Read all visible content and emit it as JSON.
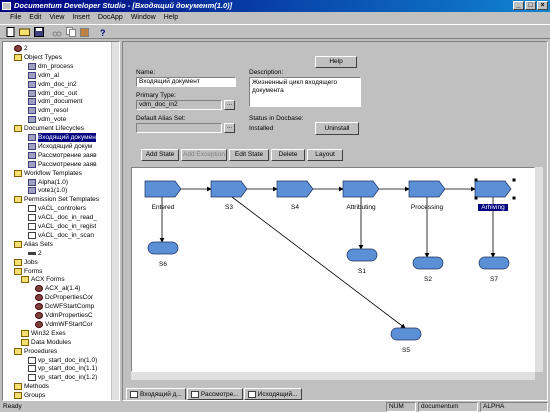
{
  "window": {
    "title": "Documentum Developer Studio - [Входящий документ(1.0)]"
  },
  "menu": [
    "File",
    "Edit",
    "View",
    "Insert",
    "DocApp",
    "Window",
    "Help"
  ],
  "toolbar": {
    "buttons": [
      "new-icon",
      "open-icon",
      "save-icon",
      "cut-icon",
      "copy-icon",
      "paste-icon",
      "help-icon"
    ]
  },
  "tree": {
    "items": [
      {
        "label": "2",
        "indent": 1,
        "icon": "gear"
      },
      {
        "label": "Object Types",
        "indent": 1,
        "icon": "folder"
      },
      {
        "label": "dm_process",
        "indent": 3,
        "icon": "item"
      },
      {
        "label": "vdm_al",
        "indent": 3,
        "icon": "item"
      },
      {
        "label": "vdm_doc_in2",
        "indent": 3,
        "icon": "item"
      },
      {
        "label": "vdm_doc_out",
        "indent": 3,
        "icon": "item"
      },
      {
        "label": "vdm_document",
        "indent": 3,
        "icon": "item"
      },
      {
        "label": "vdm_resol",
        "indent": 3,
        "icon": "item"
      },
      {
        "label": "vdm_vote",
        "indent": 3,
        "icon": "item"
      },
      {
        "label": "Document Lifecycles",
        "indent": 1,
        "icon": "folder"
      },
      {
        "label": "Входящий докумен",
        "indent": 3,
        "icon": "item",
        "selected": true
      },
      {
        "label": "Исходящий докум",
        "indent": 3,
        "icon": "item"
      },
      {
        "label": "Рассмотрение заяв",
        "indent": 3,
        "icon": "item"
      },
      {
        "label": "Рассмотрение заяв",
        "indent": 3,
        "icon": "item"
      },
      {
        "label": "Workflow Templates",
        "indent": 1,
        "icon": "folder"
      },
      {
        "label": "Alpha(1.0)",
        "indent": 3,
        "icon": "item"
      },
      {
        "label": "vote1(1.0)",
        "indent": 3,
        "icon": "item"
      },
      {
        "label": "Permission Set Templates",
        "indent": 1,
        "icon": "folder"
      },
      {
        "label": "vACL_controlers",
        "indent": 3,
        "icon": "doc"
      },
      {
        "label": "vACL_doc_in_read_",
        "indent": 3,
        "icon": "doc"
      },
      {
        "label": "vACL_doc_in_regist",
        "indent": 3,
        "icon": "doc"
      },
      {
        "label": "vACL_doc_in_scan",
        "indent": 3,
        "icon": "doc"
      },
      {
        "label": "Alias Sets",
        "indent": 1,
        "icon": "folder"
      },
      {
        "label": "2",
        "indent": 3,
        "icon": "key"
      },
      {
        "label": "Jobs",
        "indent": 1,
        "icon": "folder"
      },
      {
        "label": "Forms",
        "indent": 1,
        "icon": "folder"
      },
      {
        "label": "ACX Forms",
        "indent": 2,
        "icon": "folder"
      },
      {
        "label": "ACX_al(1.4)",
        "indent": 4,
        "icon": "gear"
      },
      {
        "label": "DcPropertiesCor",
        "indent": 4,
        "icon": "gear"
      },
      {
        "label": "DcWFStartComp",
        "indent": 4,
        "icon": "gear"
      },
      {
        "label": "VdmPropertiesC",
        "indent": 4,
        "icon": "gear"
      },
      {
        "label": "VdmWFStartCor",
        "indent": 4,
        "icon": "gear"
      },
      {
        "label": "Win32 Exes",
        "indent": 2,
        "icon": "folder"
      },
      {
        "label": "Data Modules",
        "indent": 2,
        "icon": "folder"
      },
      {
        "label": "Procedures",
        "indent": 1,
        "icon": "folder"
      },
      {
        "label": "vp_start_doc_in(1.0)",
        "indent": 3,
        "icon": "doc"
      },
      {
        "label": "vp_start_doc_in(1.1)",
        "indent": 3,
        "icon": "doc"
      },
      {
        "label": "vp_start_doc_in(1.2)",
        "indent": 3,
        "icon": "doc"
      },
      {
        "label": "Methods",
        "indent": 1,
        "icon": "folder"
      },
      {
        "label": "Groups",
        "indent": 1,
        "icon": "folder"
      }
    ]
  },
  "form": {
    "help_label": "Help",
    "name_label": "Name:",
    "name_value": "Входящий документ",
    "description_label": "Description:",
    "description_value": "Жизненный цикл входящего документа",
    "primary_type_label": "Primary Type:",
    "primary_type_value": "vdm_doc_in2",
    "default_alias_label": "Default Alias Set:",
    "default_alias_value": "",
    "status_label": "Status in Docbase:",
    "status_value": "Installed",
    "uninstall_label": "Uninstall",
    "ellipsis": "..."
  },
  "state_buttons": {
    "add_state": "Add State",
    "add_exception": "Add Exception",
    "edit_state": "Edit State",
    "delete": "Delete",
    "layout": "Layout"
  },
  "diagram": {
    "states": [
      "Entered",
      "S3",
      "S4",
      "Attributing",
      "Processing",
      "Arhiving"
    ],
    "exceptions": [
      "S6",
      "S1",
      "S2",
      "S7",
      "S5"
    ],
    "selected_state": "Arhiving",
    "state_color": "#5b8fd6"
  },
  "tabs": [
    {
      "label": "Входящий д...",
      "active": true
    },
    {
      "label": "Рассмотре...",
      "active": false
    },
    {
      "label": "Исходящий...",
      "active": false
    }
  ],
  "status": {
    "left": "Ready",
    "num": "NUM",
    "docbase": "documentum",
    "mode": "ALPHA"
  }
}
